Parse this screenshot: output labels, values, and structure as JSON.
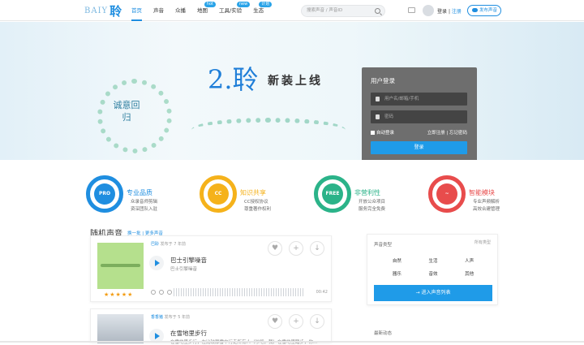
{
  "header": {
    "logo_en": "BAIY",
    "logo_cn": "聆",
    "nav": [
      {
        "label": "首页",
        "badge": ""
      },
      {
        "label": "声音",
        "badge": ""
      },
      {
        "label": "众播",
        "badge": ""
      },
      {
        "label": "地图",
        "badge": "hot"
      },
      {
        "label": "工具/实验",
        "badge": "new"
      },
      {
        "label": "生态",
        "badge": "计划"
      }
    ],
    "search_placeholder": "搜索声音 / 声音ID",
    "login": "登录",
    "separator": "|",
    "register": "注册",
    "publish": "发布声音"
  },
  "banner": {
    "seal": "诚意回归",
    "slogan_num": "2.聆",
    "slogan_cn": "新装上线",
    "login_panel": {
      "title": "用户登录",
      "user_placeholder": "用户名/邮箱/手机",
      "password_placeholder": "密码",
      "remember": "自动登录",
      "links": "立即注册 | 忘记密码",
      "button": "登录"
    }
  },
  "features": [
    {
      "icon": "PRO",
      "title": "专业品质",
      "d1": "众录音师剪辑",
      "d2": "资深团队入驻",
      "color": "#1f8ee0"
    },
    {
      "icon": "CC",
      "title": "知识共享",
      "d1": "CC授权协议",
      "d2": "尊重著作权利",
      "color": "#f5b21b"
    },
    {
      "icon": "FREE",
      "title": "非营利性",
      "d1": "开放公众项目",
      "d2": "服务完全免费",
      "color": "#2bb389"
    },
    {
      "icon": "",
      "title": "智能模块",
      "d1": "专业声频解析",
      "d2": "高效合建管理",
      "color": "#e84c4c"
    }
  ],
  "random": {
    "title": "随机声音",
    "links": "换一批 | 更多声音",
    "cards": [
      {
        "user": "巴聆",
        "when": "发布于 7 年前",
        "title": "巴士引擎噪音",
        "desc": "巴士引擎噪音",
        "stars": "★★★★★",
        "time": "00:42"
      },
      {
        "user": "香香猪",
        "when": "发布于 5 年前",
        "title": "在雪地里步行",
        "desc": "在雪地里步行，在比较厚雪中行走所有人（吵吧，我）在雪地里踏步，你..."
      }
    ]
  },
  "sidebar": {
    "head": "声音类型",
    "all": "所有类型",
    "cats": [
      "自然",
      "生活",
      "人声",
      "器乐",
      "音效",
      "其他"
    ],
    "enter": "进入声音列表"
  },
  "latest": {
    "title": "最新动态"
  }
}
